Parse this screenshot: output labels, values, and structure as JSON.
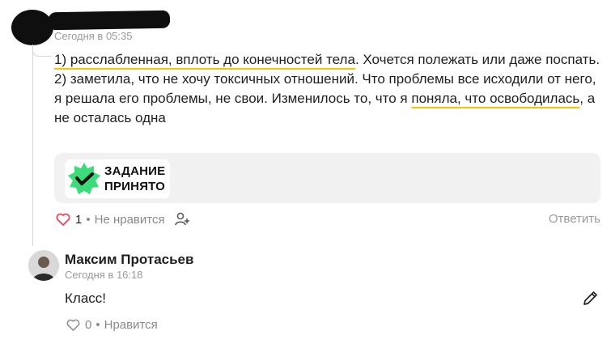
{
  "comment": {
    "timestamp": "Сегодня в 05:35",
    "lines_p1": {
      "hl1": "1) расслабленная, вплоть до конечностей тела",
      "rest1": ". Хочется полежать или даже поспать."
    },
    "lines_p2": {
      "text1": "2) заметила, что не хочу токсичных отношений. Что проблемы все исходили от него, я решала его проблемы, не свои.  Изменилось то, что я ",
      "hl2": "поняла, что освободилась",
      "text2": ", а не осталась одна"
    },
    "task_badge": {
      "line1": "ЗАДАНИЕ",
      "line2": "ПРИНЯТО",
      "icon": "check-badge-icon"
    },
    "likes_count": "1",
    "dislike_label": "Не нравится",
    "dot": "•",
    "reply_label": "Ответить"
  },
  "reply": {
    "author": "Максим Протасьев",
    "timestamp": "Сегодня в 16:18",
    "text": "Класс!",
    "likes_count": "0",
    "like_label": "Нравится",
    "dot": "•"
  },
  "colors": {
    "highlight": "#f5c400",
    "badge_green": "#3ddc7a",
    "heart_red": "#e24a5a",
    "muted": "#9a9a9a"
  }
}
